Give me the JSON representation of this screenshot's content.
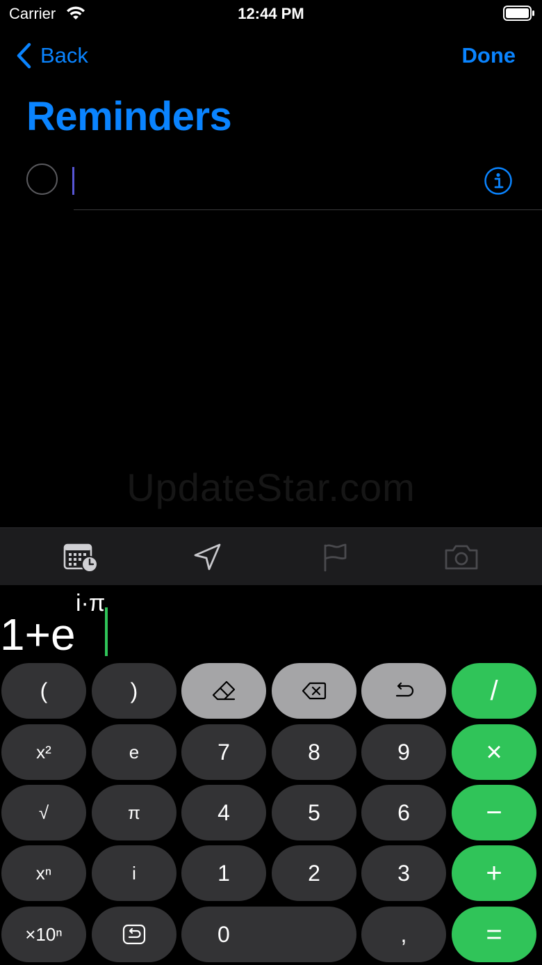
{
  "status_bar": {
    "carrier": "Carrier",
    "time": "12:44 PM"
  },
  "nav": {
    "back_label": "Back",
    "done_label": "Done"
  },
  "page": {
    "title": "Reminders"
  },
  "reminder": {
    "text": "",
    "info_icon": "info-icon"
  },
  "watermark": "UpdateStar.com",
  "toolbar": {
    "icons": [
      "calendar-clock-icon",
      "location-arrow-icon",
      "flag-icon",
      "camera-icon"
    ]
  },
  "calculator": {
    "expression_base": "1+e",
    "expression_exponent": "i·π",
    "keys": {
      "open_paren": "(",
      "close_paren": ")",
      "x_squared": "x²",
      "e": "e",
      "seven": "7",
      "eight": "8",
      "nine": "9",
      "multiply": "×",
      "sqrt": "√",
      "pi": "π",
      "four": "4",
      "five": "5",
      "six": "6",
      "minus": "−",
      "x_power_n": "xⁿ",
      "i": "i",
      "one": "1",
      "two": "2",
      "three": "3",
      "plus": "+",
      "times_ten_n": "×10ⁿ",
      "zero": "0",
      "comma": ",",
      "equals": "=",
      "divide": "/"
    },
    "colors": {
      "operator": "#30c459",
      "function": "#a5a5a7",
      "digit": "#333335",
      "accent": "#0a84ff"
    }
  }
}
